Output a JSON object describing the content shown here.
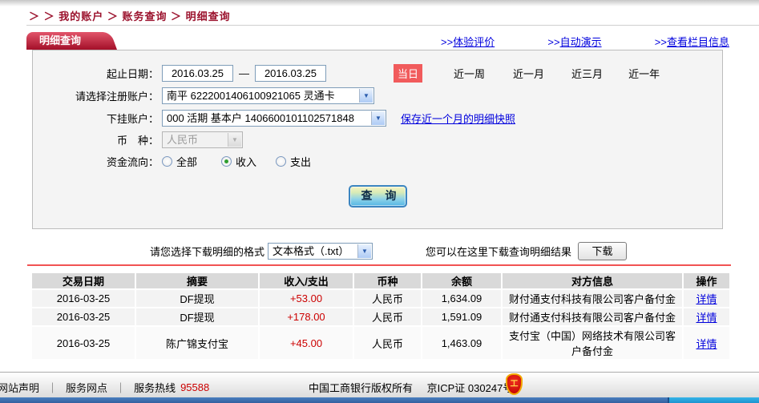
{
  "breadcrumb": "＞ ＞ 我的账户 ＞ 账务查询 ＞ 明细查询",
  "panel": {
    "tab_label": "明细查询",
    "links": [
      {
        "prefix": ">>",
        "label": "体验评价"
      },
      {
        "prefix": ">>",
        "label": "自动演示"
      },
      {
        "prefix": ">>",
        "label": "查看栏目信息"
      }
    ]
  },
  "form": {
    "date_label": "起止日期：",
    "date_from": "2016.03.25",
    "date_separator": "—",
    "date_to": "2016.03.25",
    "today_label": "当日",
    "quick_ranges": [
      "近一周",
      "近一月",
      "近三月",
      "近一年"
    ],
    "register_account_label": "请选择注册账户：",
    "register_account_value": "南平  6222001406100921065 灵通卡",
    "sub_account_label": "下挂账户：",
    "sub_account_value": "000 活期 基本户 1406600101102571848",
    "snapshot_link": "保存近一个月的明细快照",
    "currency_label": "币　种：",
    "currency_value": "人民币",
    "flow_label": "资金流向：",
    "flow_options": [
      {
        "label": "全部",
        "checked": false
      },
      {
        "label": "收入",
        "checked": true
      },
      {
        "label": "支出",
        "checked": false
      }
    ],
    "query_button": "查 询"
  },
  "download": {
    "format_label": "请您选择下载明细的格式",
    "format_value": "文本格式（.txt）",
    "hint": "您可以在这里下载查询明细结果",
    "button": "下载"
  },
  "table": {
    "headers": [
      "交易日期",
      "摘要",
      "收入/支出",
      "币种",
      "余额",
      "对方信息",
      "操作"
    ],
    "rows": [
      {
        "date": "2016-03-25",
        "summary": "DF提现",
        "amount": "+53.00",
        "currency": "人民币",
        "balance": "1,634.09",
        "counterparty": "财付通支付科技有限公司客户备付金",
        "action": "详情"
      },
      {
        "date": "2016-03-25",
        "summary": "DF提现",
        "amount": "+178.00",
        "currency": "人民币",
        "balance": "1,591.09",
        "counterparty": "财付通支付科技有限公司客户备付金",
        "action": "详情"
      },
      {
        "date": "2016-03-25",
        "summary": "陈广锦支付宝",
        "amount": "+45.00",
        "currency": "人民币",
        "balance": "1,463.09",
        "counterparty": "支付宝（中国）网络技术有限公司客户备付金",
        "action": "详情"
      }
    ]
  },
  "footer": {
    "links": [
      "网站声明",
      "服务网点"
    ],
    "separator": "｜",
    "hotline_label": "服务热线",
    "hotline_number": "95588",
    "copyright": "中国工商银行版权所有",
    "icp": "京ICP证 030247号",
    "badge_icon": "security-badge",
    "badge_glyph": "工"
  },
  "colors": {
    "brand_red": "#A30F28",
    "breadcrumb_red": "#9B122D",
    "link_blue": "#0000DD",
    "today_red": "#F15B5C",
    "amount_red": "#CC0000",
    "divider_red": "#F15353",
    "table_header_gray": "#D9D9D9",
    "row_gray": "#F3F3F3",
    "panel_gray": "#F4F4F4",
    "input_border": "#7F9DB9",
    "footer_blue_left": "#33609F",
    "footer_blue_right": "#1E93CF"
  }
}
